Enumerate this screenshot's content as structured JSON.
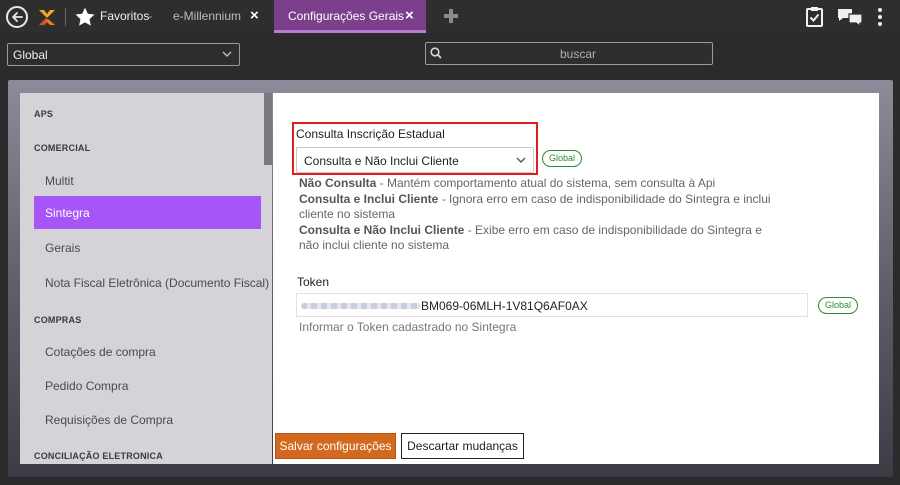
{
  "topbar": {
    "favorites_label": "Favoritos",
    "favorites_arrow": "⌄",
    "tab_emillennium": "e-Millennium",
    "tab_active": "Configurações Gerais",
    "close_glyph": "×"
  },
  "subbar": {
    "scope_value": "Global",
    "search_placeholder": "buscar"
  },
  "sidebar": {
    "headers": [
      "APS",
      "COMERCIAL",
      "COMPRAS",
      "CONCILIAÇÃO ELETRONICA"
    ],
    "comercial_items": [
      "Multit",
      "Sintegra",
      "Gerais",
      "Nota Fiscal Eletrônica (Documento Fiscal)"
    ],
    "compras_items": [
      "Cotações de compra",
      "Pedido Compra",
      "Requisições de Compra"
    ]
  },
  "form": {
    "ie_label": "Consulta Inscrição Estadual",
    "ie_value": "Consulta e Não Inclui Cliente",
    "badge": "Global",
    "desc1_bold": "Não Consulta",
    "desc1_text": " - Mantém comportamento atual do sistema, sem consulta à Api",
    "desc2_bold": "Consulta e Inclui Cliente",
    "desc2_text": " - Ignora erro em caso de indisponibilidade do Sintegra e inclui",
    "desc2_cont": "cliente no sistema",
    "desc3_bold": "Consulta e Não Inclui Cliente",
    "desc3_text": " - Exibe erro em caso de indisponibilidade do Sintegra e",
    "desc3_cont": "não inclui cliente no sistema",
    "token_label": "Token",
    "token_value": "BM069-06MLH-1V81Q6AF0AX",
    "token_help": "Informar o Token cadastrado no Sintegra"
  },
  "actions": {
    "save": "Salvar configurações",
    "discard": "Descartar mudanças"
  },
  "colors": {
    "active_tab": "#7b3f8c",
    "sidebar_active": "#a855f7",
    "save_button": "#d2691e",
    "badge_green": "#2e8b2e",
    "highlight_red": "#e01e1e"
  },
  "icons": [
    "back-arrow-icon",
    "logo-icon",
    "star-icon",
    "close-icon",
    "plus-icon",
    "clipboard-check-icon",
    "chat-icon",
    "more-vertical-icon",
    "chevron-down-icon",
    "search-icon"
  ]
}
